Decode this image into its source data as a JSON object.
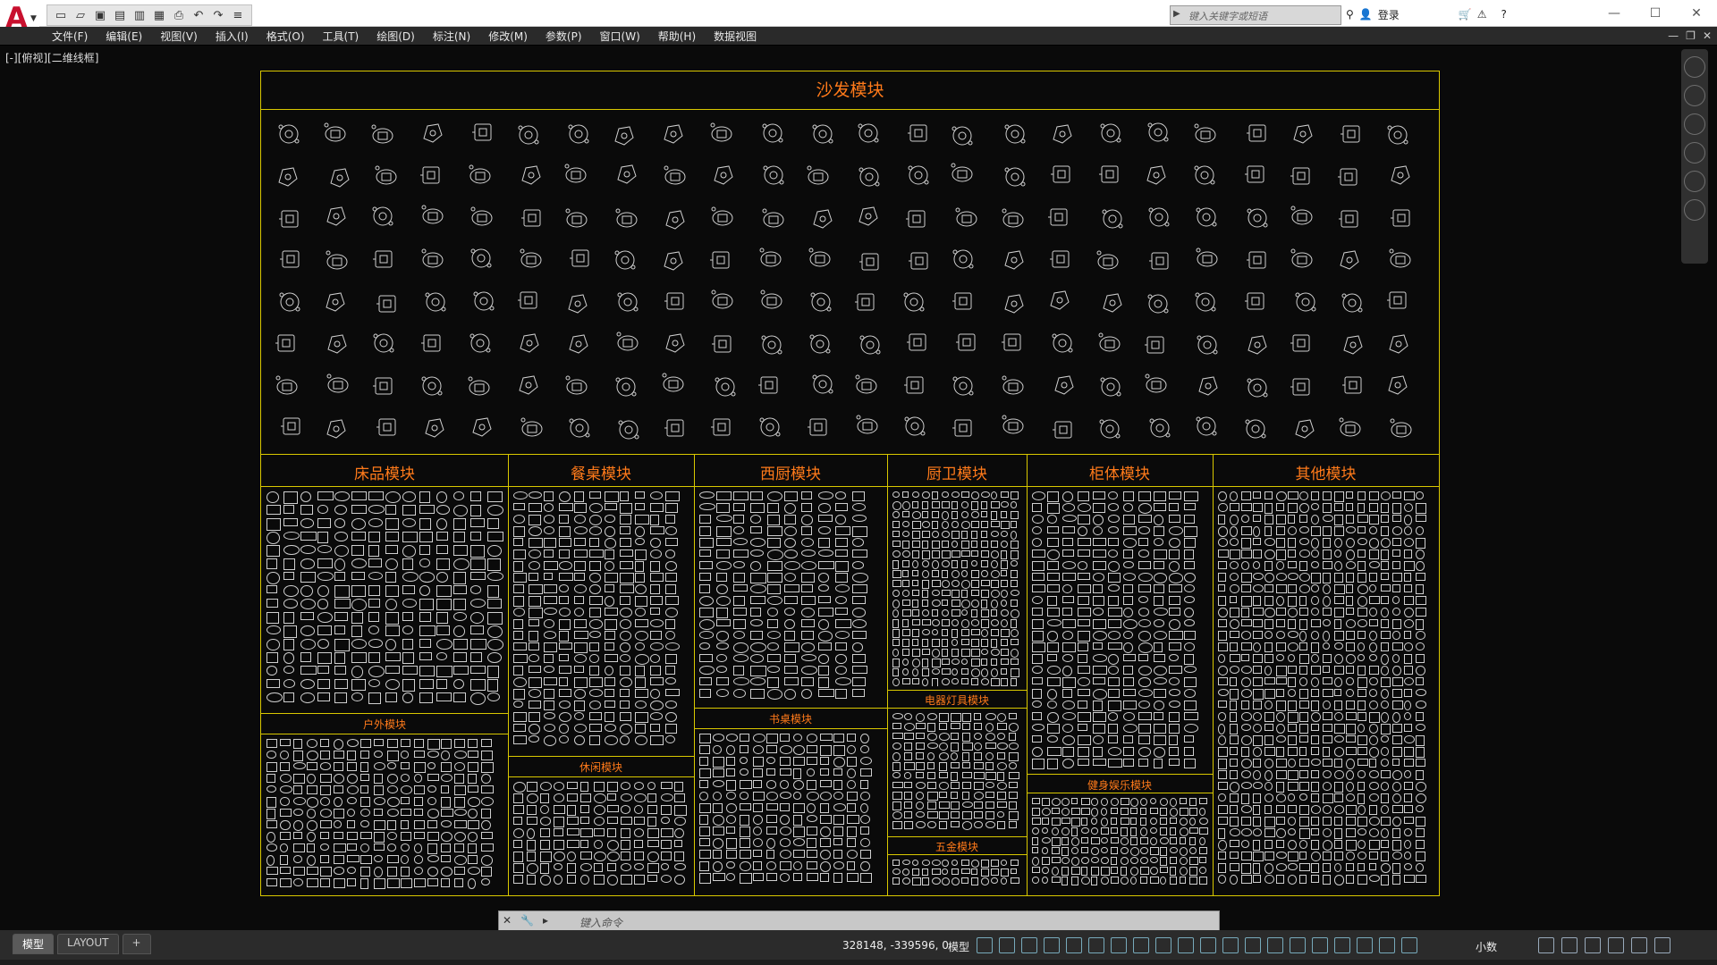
{
  "titlebar": {
    "search_placeholder": "键入关键字或短语",
    "login_label": "登录"
  },
  "menu": {
    "items": [
      "文件(F)",
      "编辑(E)",
      "视图(V)",
      "插入(I)",
      "格式(O)",
      "工具(T)",
      "绘图(D)",
      "标注(N)",
      "修改(M)",
      "参数(P)",
      "窗口(W)",
      "帮助(H)",
      "数据视图"
    ]
  },
  "viewport": {
    "label": "[-][俯视][二维线框]"
  },
  "drawing": {
    "sofa_title": "沙发模块",
    "bed_title": "床品模块",
    "dining_title": "餐桌模块",
    "kitchen_title": "西厨模块",
    "bath_title": "厨卫模块",
    "cabinet_title": "柜体模块",
    "other_title": "其他模块",
    "outdoor_title": "户外模块",
    "leisure_title": "休闲模块",
    "desk_title": "书桌模块",
    "appliance_title": "电器灯具模块",
    "hardware_title": "五金模块",
    "fitness_title": "健身娱乐模块"
  },
  "command": {
    "placeholder": "键入命令"
  },
  "status": {
    "tab_model": "模型",
    "tab_layout": "LAYOUT",
    "tab_add": "+",
    "coordinates": "328148, -339596, 0",
    "space": "模型",
    "units": "小数"
  },
  "colors": {
    "frame": "#d9c800",
    "title_text": "#ff7a1a",
    "symbols": "#cfcfcf"
  }
}
